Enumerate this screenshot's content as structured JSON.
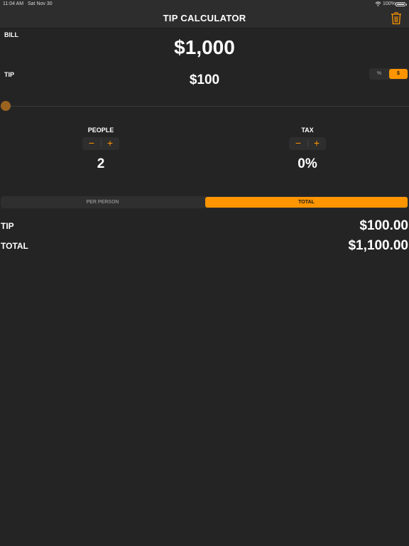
{
  "status_bar": {
    "time": "11:04 AM",
    "date": "Sat Nov 30",
    "battery": "100%",
    "icons": [
      "wifi-icon",
      "battery-icon"
    ]
  },
  "nav": {
    "title": "TIP CALCULATOR",
    "trash_icon": "trash-icon"
  },
  "bill": {
    "label": "BILL",
    "amount": "$1,000"
  },
  "tip": {
    "label": "TIP",
    "amount": "$100",
    "mode_options": [
      "%",
      "$"
    ],
    "selected_mode": "$",
    "slider_fraction": 0
  },
  "people": {
    "label": "PEOPLE",
    "minus": "−",
    "plus": "+",
    "value": "2"
  },
  "tax": {
    "label": "TAX",
    "minus": "−",
    "plus": "+",
    "value": "0%"
  },
  "view_toggle": {
    "options": [
      "PER PERSON",
      "TOTAL"
    ],
    "selected": "TOTAL"
  },
  "results": {
    "tip_label": "TIP",
    "tip_value": "$100.00",
    "total_label": "TOTAL",
    "total_value": "$1,100.00"
  },
  "colors": {
    "background": "#242424",
    "bar": "#2d2d2d",
    "accent": "#ff9500",
    "slider_thumb": "#9b6320",
    "text": "#ffffff",
    "muted": "#8a8a8a"
  }
}
